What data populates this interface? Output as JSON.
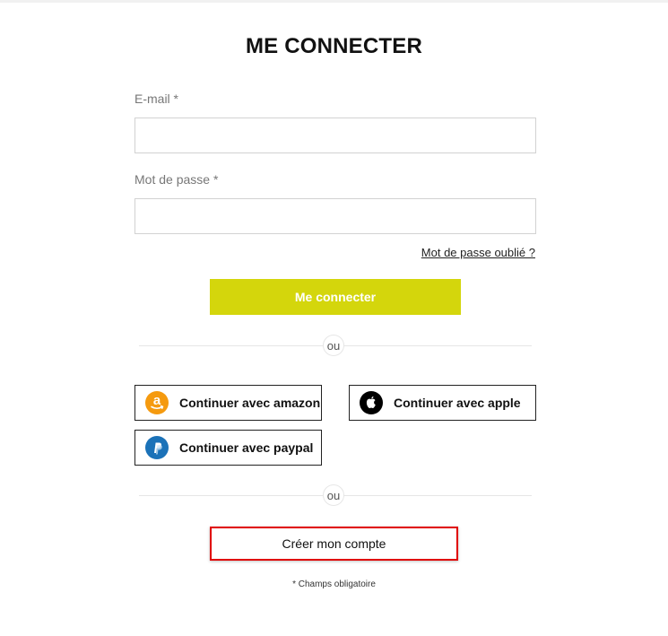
{
  "page": {
    "title": "ME CONNECTER",
    "required_note": "* Champs obligatoire"
  },
  "form": {
    "email_label": "E-mail",
    "email_required": " *",
    "email_value": "",
    "password_label": "Mot de passe",
    "password_required": " *",
    "password_value": "",
    "forgot_link": "Mot de passe oublié ?",
    "submit_label": "Me connecter"
  },
  "dividers": {
    "first": "ou",
    "second": "ou"
  },
  "social": {
    "amazon_label": "Continuer avec amazon",
    "apple_label": "Continuer avec apple",
    "paypal_label": "Continuer avec paypal"
  },
  "account": {
    "create_label": "Créer mon compte"
  },
  "colors": {
    "accent": "#d4d60c",
    "highlight_border": "#e00000",
    "amazon": "#f59a0f",
    "apple": "#000000",
    "paypal": "#1b72b8"
  },
  "icons": {
    "amazon": "amazon-logo-icon",
    "apple": "apple-logo-icon",
    "paypal": "paypal-logo-icon"
  }
}
